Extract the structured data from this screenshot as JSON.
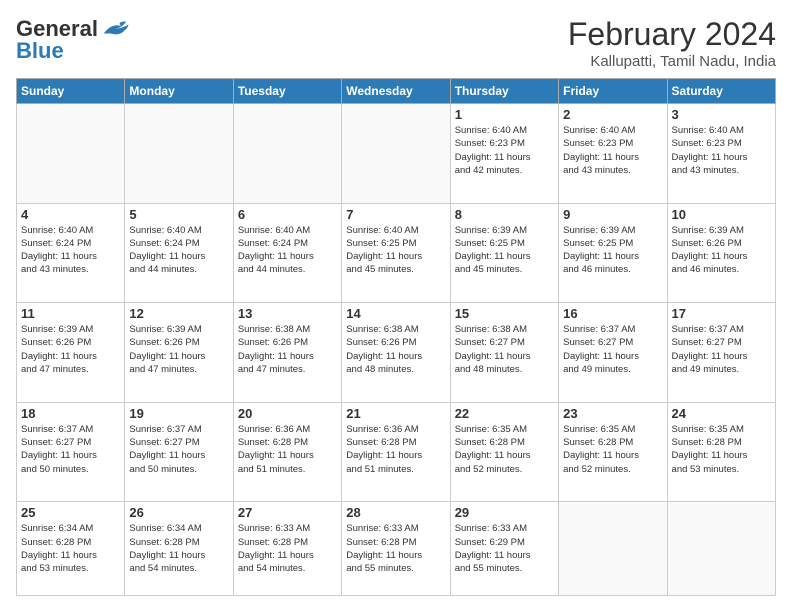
{
  "header": {
    "logo_general": "General",
    "logo_blue": "Blue",
    "month_year": "February 2024",
    "location": "Kallupatti, Tamil Nadu, India"
  },
  "days_of_week": [
    "Sunday",
    "Monday",
    "Tuesday",
    "Wednesday",
    "Thursday",
    "Friday",
    "Saturday"
  ],
  "weeks": [
    [
      {
        "day": "",
        "info": ""
      },
      {
        "day": "",
        "info": ""
      },
      {
        "day": "",
        "info": ""
      },
      {
        "day": "",
        "info": ""
      },
      {
        "day": "1",
        "info": "Sunrise: 6:40 AM\nSunset: 6:23 PM\nDaylight: 11 hours\nand 42 minutes."
      },
      {
        "day": "2",
        "info": "Sunrise: 6:40 AM\nSunset: 6:23 PM\nDaylight: 11 hours\nand 43 minutes."
      },
      {
        "day": "3",
        "info": "Sunrise: 6:40 AM\nSunset: 6:23 PM\nDaylight: 11 hours\nand 43 minutes."
      }
    ],
    [
      {
        "day": "4",
        "info": "Sunrise: 6:40 AM\nSunset: 6:24 PM\nDaylight: 11 hours\nand 43 minutes."
      },
      {
        "day": "5",
        "info": "Sunrise: 6:40 AM\nSunset: 6:24 PM\nDaylight: 11 hours\nand 44 minutes."
      },
      {
        "day": "6",
        "info": "Sunrise: 6:40 AM\nSunset: 6:24 PM\nDaylight: 11 hours\nand 44 minutes."
      },
      {
        "day": "7",
        "info": "Sunrise: 6:40 AM\nSunset: 6:25 PM\nDaylight: 11 hours\nand 45 minutes."
      },
      {
        "day": "8",
        "info": "Sunrise: 6:39 AM\nSunset: 6:25 PM\nDaylight: 11 hours\nand 45 minutes."
      },
      {
        "day": "9",
        "info": "Sunrise: 6:39 AM\nSunset: 6:25 PM\nDaylight: 11 hours\nand 46 minutes."
      },
      {
        "day": "10",
        "info": "Sunrise: 6:39 AM\nSunset: 6:26 PM\nDaylight: 11 hours\nand 46 minutes."
      }
    ],
    [
      {
        "day": "11",
        "info": "Sunrise: 6:39 AM\nSunset: 6:26 PM\nDaylight: 11 hours\nand 47 minutes."
      },
      {
        "day": "12",
        "info": "Sunrise: 6:39 AM\nSunset: 6:26 PM\nDaylight: 11 hours\nand 47 minutes."
      },
      {
        "day": "13",
        "info": "Sunrise: 6:38 AM\nSunset: 6:26 PM\nDaylight: 11 hours\nand 47 minutes."
      },
      {
        "day": "14",
        "info": "Sunrise: 6:38 AM\nSunset: 6:26 PM\nDaylight: 11 hours\nand 48 minutes."
      },
      {
        "day": "15",
        "info": "Sunrise: 6:38 AM\nSunset: 6:27 PM\nDaylight: 11 hours\nand 48 minutes."
      },
      {
        "day": "16",
        "info": "Sunrise: 6:37 AM\nSunset: 6:27 PM\nDaylight: 11 hours\nand 49 minutes."
      },
      {
        "day": "17",
        "info": "Sunrise: 6:37 AM\nSunset: 6:27 PM\nDaylight: 11 hours\nand 49 minutes."
      }
    ],
    [
      {
        "day": "18",
        "info": "Sunrise: 6:37 AM\nSunset: 6:27 PM\nDaylight: 11 hours\nand 50 minutes."
      },
      {
        "day": "19",
        "info": "Sunrise: 6:37 AM\nSunset: 6:27 PM\nDaylight: 11 hours\nand 50 minutes."
      },
      {
        "day": "20",
        "info": "Sunrise: 6:36 AM\nSunset: 6:28 PM\nDaylight: 11 hours\nand 51 minutes."
      },
      {
        "day": "21",
        "info": "Sunrise: 6:36 AM\nSunset: 6:28 PM\nDaylight: 11 hours\nand 51 minutes."
      },
      {
        "day": "22",
        "info": "Sunrise: 6:35 AM\nSunset: 6:28 PM\nDaylight: 11 hours\nand 52 minutes."
      },
      {
        "day": "23",
        "info": "Sunrise: 6:35 AM\nSunset: 6:28 PM\nDaylight: 11 hours\nand 52 minutes."
      },
      {
        "day": "24",
        "info": "Sunrise: 6:35 AM\nSunset: 6:28 PM\nDaylight: 11 hours\nand 53 minutes."
      }
    ],
    [
      {
        "day": "25",
        "info": "Sunrise: 6:34 AM\nSunset: 6:28 PM\nDaylight: 11 hours\nand 53 minutes."
      },
      {
        "day": "26",
        "info": "Sunrise: 6:34 AM\nSunset: 6:28 PM\nDaylight: 11 hours\nand 54 minutes."
      },
      {
        "day": "27",
        "info": "Sunrise: 6:33 AM\nSunset: 6:28 PM\nDaylight: 11 hours\nand 54 minutes."
      },
      {
        "day": "28",
        "info": "Sunrise: 6:33 AM\nSunset: 6:28 PM\nDaylight: 11 hours\nand 55 minutes."
      },
      {
        "day": "29",
        "info": "Sunrise: 6:33 AM\nSunset: 6:29 PM\nDaylight: 11 hours\nand 55 minutes."
      },
      {
        "day": "",
        "info": ""
      },
      {
        "day": "",
        "info": ""
      }
    ]
  ]
}
